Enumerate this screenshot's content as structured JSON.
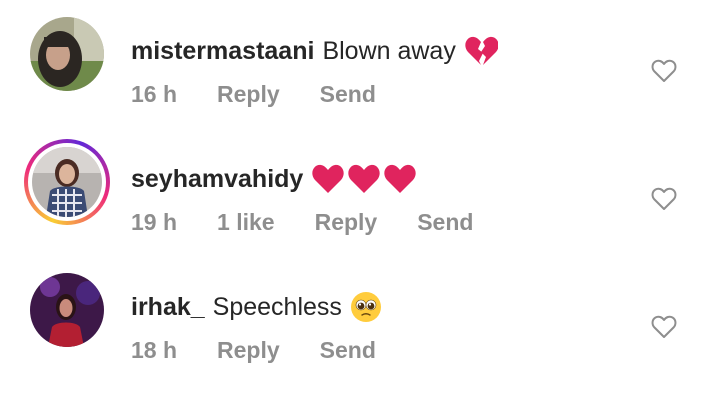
{
  "comments": [
    {
      "username": "mistermastaani",
      "text": "Blown away",
      "emoji": [
        "broken-heart"
      ],
      "time": "16 h",
      "likes": "",
      "reply_label": "Reply",
      "send_label": "Send",
      "has_story_ring": false
    },
    {
      "username": "seyhamvahidy",
      "text": "",
      "emoji": [
        "red-heart",
        "red-heart",
        "red-heart"
      ],
      "time": "19 h",
      "likes": "1 like",
      "reply_label": "Reply",
      "send_label": "Send",
      "has_story_ring": true
    },
    {
      "username": "irhak_",
      "text": "Speechless",
      "emoji": [
        "pleading-face"
      ],
      "time": "18 h",
      "likes": "",
      "reply_label": "Reply",
      "send_label": "Send",
      "has_story_ring": false
    }
  ],
  "icons": {
    "like": "heart-outline-icon"
  },
  "colors": {
    "text": "#262626",
    "meta": "#8e8e8e",
    "heart_red": "#e0245e",
    "ring_gradient": [
      "#f9ce34",
      "#ee2a7b",
      "#6228d7"
    ]
  }
}
